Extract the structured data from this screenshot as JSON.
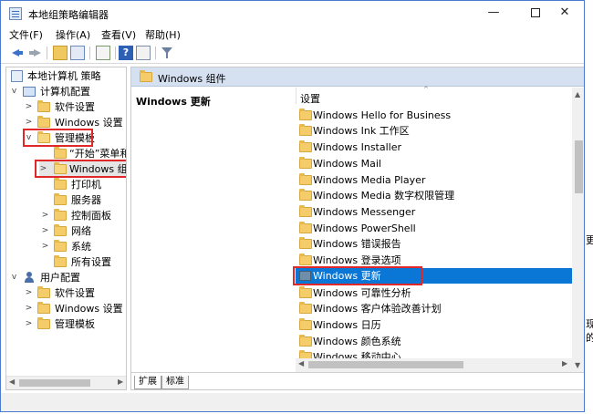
{
  "window": {
    "title": "本地组策略编辑器",
    "controls": {
      "minimize": "—",
      "maximize": "",
      "close": "✕"
    }
  },
  "menu": [
    "文件(F)",
    "操作(A)",
    "查看(V)",
    "帮助(H)"
  ],
  "toolbar": [
    "back-arrow-icon",
    "forward-arrow-icon",
    "up-folder-icon",
    "show-hide-tree-icon",
    "export-list-icon",
    "help-icon",
    "properties-icon",
    "filter-icon"
  ],
  "tree": {
    "root": "本地计算机 策略",
    "items": [
      {
        "label": "计算机配置"
      },
      {
        "label": "软件设置"
      },
      {
        "label": "Windows 设置"
      },
      {
        "label": "管理模板"
      },
      {
        "label": "“开始”菜单和"
      },
      {
        "label": "Windows 组"
      },
      {
        "label": "打印机"
      },
      {
        "label": "服务器"
      },
      {
        "label": "控制面板"
      },
      {
        "label": "网络"
      },
      {
        "label": "系统"
      },
      {
        "label": "所有设置"
      },
      {
        "label": "用户配置"
      },
      {
        "label": "软件设置"
      },
      {
        "label": "Windows 设置"
      },
      {
        "label": "管理模板"
      }
    ]
  },
  "right": {
    "header": "Windows 组件",
    "description_title": "Windows 更新",
    "column_header": "设置",
    "items": [
      "Windows Hello for Business",
      "Windows Ink 工作区",
      "Windows Installer",
      "Windows Mail",
      "Windows Media Player",
      "Windows Media 数字权限管理",
      "Windows Messenger",
      "Windows PowerShell",
      "Windows 错误报告",
      "Windows 登录选项",
      "Windows 更新",
      "Windows 可靠性分析",
      "Windows 客户体验改善计划",
      "Windows 日历",
      "Windows 颜色系统",
      "Windows 移动中心"
    ],
    "selected_index": 10,
    "tabs": [
      "扩展",
      "标准"
    ]
  },
  "edge_fragments": [
    "更",
    "现",
    "的"
  ],
  "accent": {
    "selection": "#0a77d6",
    "highlight_box": "#e02828",
    "header_bg": "#d5e1f0"
  }
}
